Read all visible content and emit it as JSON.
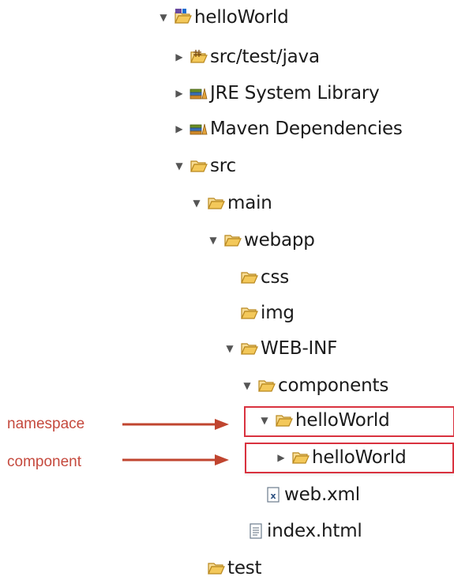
{
  "tree": {
    "items": [
      {
        "label": "helloWorld",
        "icon": "maven-project-icon",
        "toggle": "▼"
      },
      {
        "label": "src/test/java",
        "icon": "source-folder-icon",
        "toggle": "▶"
      },
      {
        "label": "JRE System Library",
        "icon": "library-icon",
        "toggle": "▶"
      },
      {
        "label": "Maven Dependencies",
        "icon": "library-icon",
        "toggle": "▶"
      },
      {
        "label": "src",
        "icon": "folder-icon",
        "toggle": "▼"
      },
      {
        "label": "main",
        "icon": "folder-icon",
        "toggle": "▼"
      },
      {
        "label": "webapp",
        "icon": "folder-icon",
        "toggle": "▼"
      },
      {
        "label": "css",
        "icon": "folder-icon",
        "toggle": ""
      },
      {
        "label": "img",
        "icon": "folder-icon",
        "toggle": ""
      },
      {
        "label": "WEB-INF",
        "icon": "folder-icon",
        "toggle": "▼"
      },
      {
        "label": "components",
        "icon": "folder-icon",
        "toggle": "▼"
      },
      {
        "label": "helloWorld",
        "icon": "folder-icon",
        "toggle": "▼"
      },
      {
        "label": "helloWorld",
        "icon": "folder-icon",
        "toggle": "▶"
      },
      {
        "label": "web.xml",
        "icon": "xml-file-icon",
        "toggle": ""
      },
      {
        "label": "index.html",
        "icon": "html-file-icon",
        "toggle": ""
      },
      {
        "label": "test",
        "icon": "folder-icon",
        "toggle": ""
      }
    ]
  },
  "annotations": {
    "namespace": "namespace",
    "component": "component",
    "color": "#c54a3e"
  },
  "colors": {
    "folder": "#e7b64a",
    "highlight": "#d9323f"
  }
}
